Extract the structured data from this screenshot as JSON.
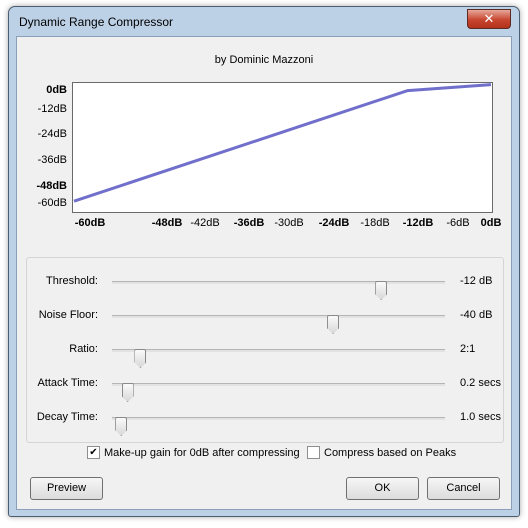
{
  "window": {
    "title": "Dynamic Range Compressor",
    "close_glyph": "✕"
  },
  "byline": "by Dominic Mazzoni",
  "graph": {
    "y_labels": [
      "0dB",
      "-12dB",
      "-24dB",
      "-36dB",
      "-48dB",
      "-60dB"
    ],
    "x_labels": [
      "-60dB",
      "-48dB",
      "-42dB",
      "-36dB",
      "-30dB",
      "-24dB",
      "-18dB",
      "-12dB",
      "-6dB",
      "0dB"
    ],
    "curve_color": "#7070cc",
    "curve": {
      "input_db": [
        -60,
        -12,
        0
      ],
      "output_db": [
        -57.6,
        -1.8,
        1.2
      ]
    }
  },
  "controls": [
    {
      "label": "Threshold:",
      "value": "-12 dB",
      "position": 0.82
    },
    {
      "label": "Noise Floor:",
      "value": "-40 dB",
      "position": 0.67
    },
    {
      "label": "Ratio:",
      "value": "2:1",
      "position": 0.07
    },
    {
      "label": "Attack Time:",
      "value": "0.2 secs",
      "position": 0.03
    },
    {
      "label": "Decay Time:",
      "value": "1.0 secs",
      "position": 0.01
    }
  ],
  "checkboxes": {
    "makeup": {
      "label": "Make-up gain for 0dB after compressing",
      "checked": true
    },
    "peaks": {
      "label": "Compress based on Peaks",
      "checked": false
    }
  },
  "buttons": {
    "preview": "Preview",
    "ok": "OK",
    "cancel": "Cancel"
  }
}
